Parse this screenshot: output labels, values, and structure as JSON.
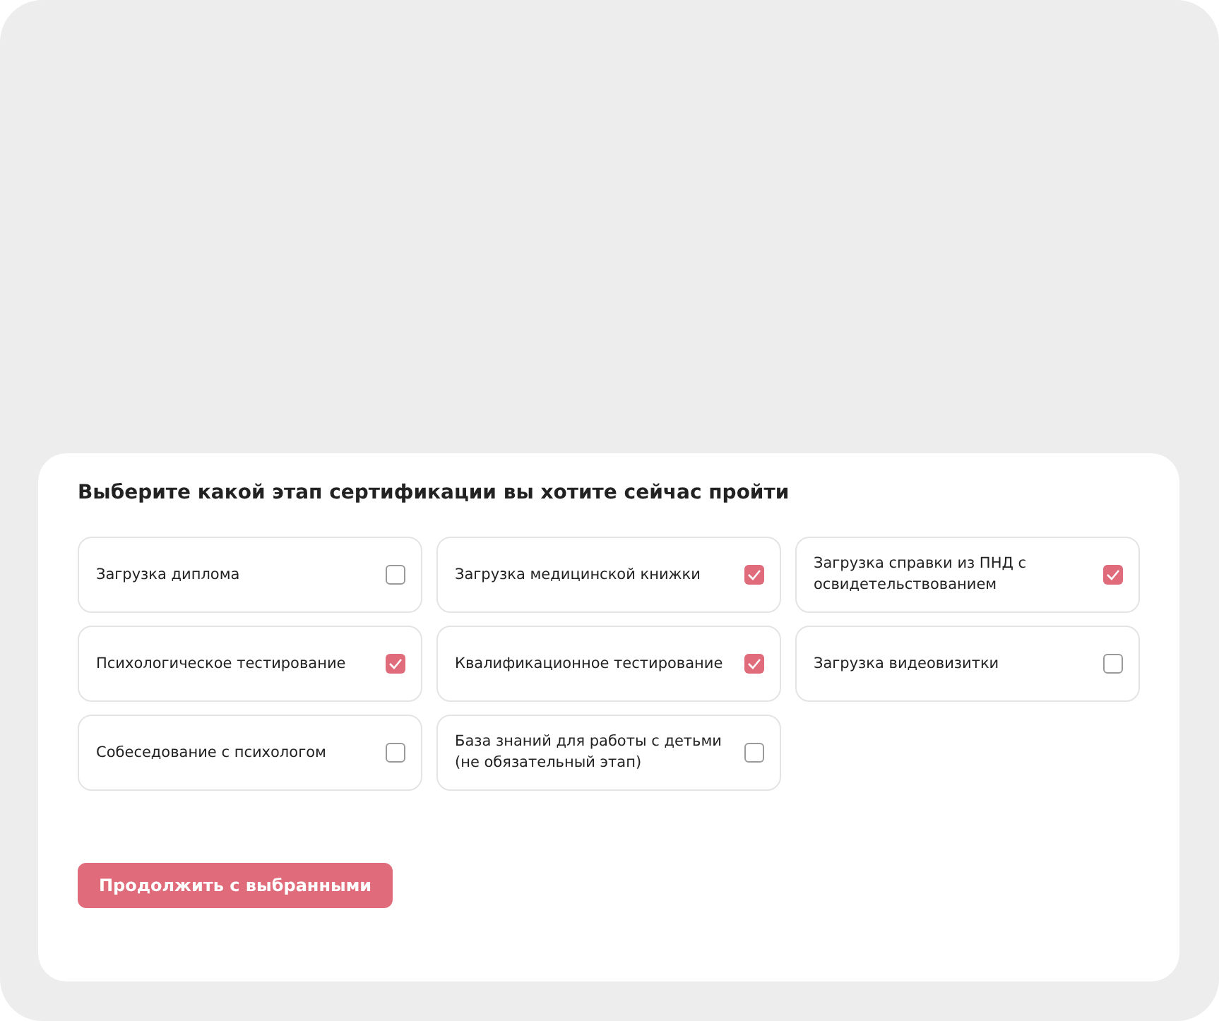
{
  "title": "Выберите какой этап сертификации вы хотите сейчас пройти",
  "options": [
    {
      "label": "Загрузка диплома",
      "checked": false
    },
    {
      "label": "Загрузка медицинской книжки",
      "checked": true
    },
    {
      "label": "Загрузка справки из ПНД с освидетельствованием",
      "checked": true
    },
    {
      "label": "Психологическое тестирование",
      "checked": true
    },
    {
      "label": "Квалификационное тестирование",
      "checked": true
    },
    {
      "label": "Загрузка видеовизитки",
      "checked": false
    },
    {
      "label": "Собеседование с психологом",
      "checked": false
    },
    {
      "label": "База знаний для работы с детьми (не обязательный этап)",
      "checked": false
    }
  ],
  "button": "Продолжить с выбранными"
}
